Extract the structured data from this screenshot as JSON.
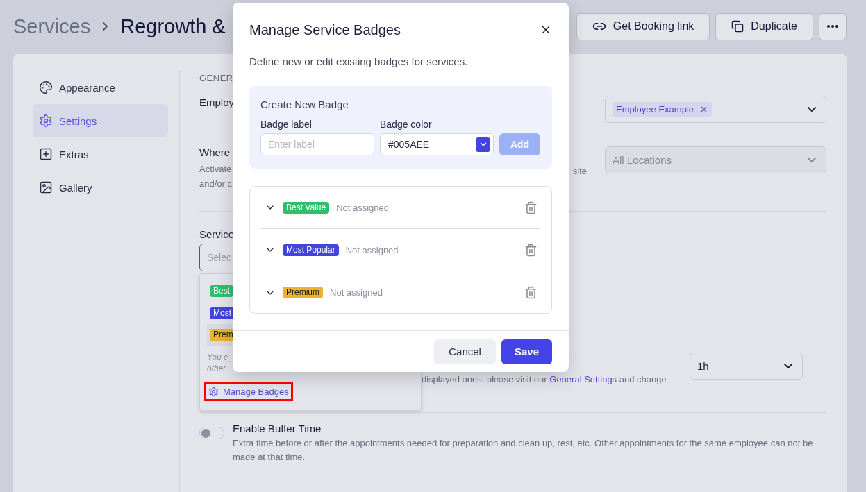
{
  "breadcrumb": {
    "parent": "Services",
    "current": "Regrowth &"
  },
  "header_actions": [
    {
      "kind": "link",
      "label": "Get Booking link"
    },
    {
      "kind": "duplicate",
      "label": "Duplicate"
    },
    {
      "kind": "more"
    }
  ],
  "sidebar": {
    "items": [
      {
        "kind": "appearance",
        "label": "Appearance",
        "selected": false
      },
      {
        "kind": "settings",
        "label": "Settings",
        "selected": true
      },
      {
        "kind": "extras",
        "label": "Extras",
        "selected": false
      },
      {
        "kind": "gallery",
        "label": "Gallery",
        "selected": false
      }
    ]
  },
  "settings": {
    "section_title": "GENER",
    "employees": {
      "label": "Employ",
      "chips": [
        "Employee Example"
      ]
    },
    "locations": {
      "title": "Where",
      "description_start": [
        "Activate",
        "and/or c"
      ],
      "description_end": "site",
      "select": {
        "value": "All Locations",
        "disabled": true
      }
    },
    "badges": {
      "label": "Service",
      "select": {
        "placeholder": "Selec"
      },
      "dropdown": {
        "options": [
          {
            "label": "Best",
            "color": "#2fbf6a",
            "selected": false
          },
          {
            "label": "Most",
            "color": "#4343e0",
            "selected": false
          },
          {
            "label": "Prem",
            "color": "#e9b429",
            "selected": true
          }
        ],
        "note_lines": [
          "You c",
          "other"
        ],
        "manage_link": {
          "label": "Manage Badges",
          "highlighted": true
        }
      }
    },
    "time": {
      "text_before": "displayed ones, please visit our ",
      "link": "General Settings",
      "text_after": " and change",
      "select": {
        "value": "1h"
      }
    },
    "buffer": {
      "title": "Enable Buffer Time",
      "on": false,
      "description": "Extra time before or after the appointments needed for preparation and clean up, rest, etc. Other appointments for the same employee can not be made at that time."
    }
  },
  "modal": {
    "title": "Manage Service Badges",
    "subtitle": "Define new or edit existing badges for services.",
    "create": {
      "title": "Create New Badge",
      "label_field": {
        "label": "Badge label",
        "placeholder": "Enter label"
      },
      "color_field": {
        "label": "Badge color",
        "value": "#005AEE"
      },
      "add_button": {
        "label": "Add",
        "disabled": true
      }
    },
    "badges": [
      {
        "label": "Best Value",
        "color": "#2fbf6a",
        "status": "Not assigned",
        "expanded": false
      },
      {
        "label": "Most Popular",
        "color": "#4343e0",
        "status": "Not assigned",
        "expanded": false
      },
      {
        "label": "Premium",
        "color": "#e9b429",
        "status": "Not assigned",
        "expanded": false
      }
    ],
    "buttons": [
      {
        "kind": "secondary",
        "label": "Cancel"
      },
      {
        "kind": "primary",
        "label": "Save"
      }
    ]
  }
}
